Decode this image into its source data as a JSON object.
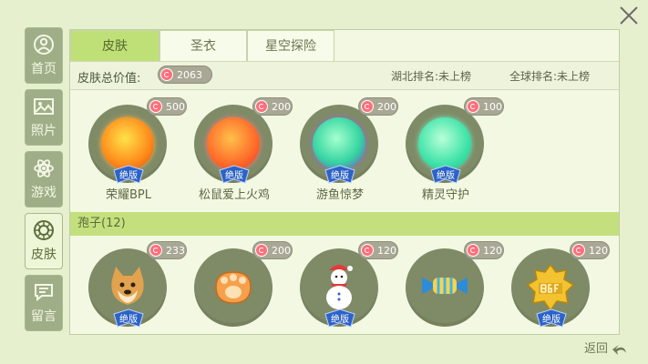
{
  "tabs": [
    "皮肤",
    "圣衣",
    "星空探险"
  ],
  "sidebar": [
    {
      "label": "首页",
      "icon": "user-icon"
    },
    {
      "label": "照片",
      "icon": "photo-icon"
    },
    {
      "label": "游戏",
      "icon": "atom-icon"
    },
    {
      "label": "皮肤",
      "icon": "skin-icon"
    },
    {
      "label": "留言",
      "icon": "message-icon"
    }
  ],
  "summary": {
    "total_label": "皮肤总价值:",
    "total_value": "2063",
    "hubei_rank": "湖北排名:未上榜",
    "global_rank": "全球排名:未上榜"
  },
  "skins": [
    {
      "name": "荣耀BPL",
      "price": "500",
      "badge": "绝版",
      "icon": "fire-orb-icon"
    },
    {
      "name": "松鼠爱上火鸡",
      "price": "200",
      "badge": "绝版",
      "icon": "orange-orb-icon"
    },
    {
      "name": "游鱼惊梦",
      "price": "200",
      "badge": "绝版",
      "icon": "teal-orb-icon"
    },
    {
      "name": "精灵守护",
      "price": "100",
      "badge": "绝版",
      "icon": "green-orb-icon"
    }
  ],
  "spores_header": "孢子(12)",
  "spores": [
    {
      "price": "233",
      "badge": "绝版",
      "icon": "doge-icon"
    },
    {
      "price": "200",
      "badge": "",
      "icon": "paw-icon"
    },
    {
      "price": "120",
      "badge": "绝版",
      "icon": "snowman-icon"
    },
    {
      "price": "120",
      "badge": "",
      "icon": "candy-icon"
    },
    {
      "price": "120",
      "badge": "绝版",
      "icon": "bgf-badge-icon"
    }
  ],
  "back_label": "返回",
  "colors": {
    "accent": "#bfe077",
    "sidebar": "#9fae86",
    "panel": "#f3f8e2"
  }
}
